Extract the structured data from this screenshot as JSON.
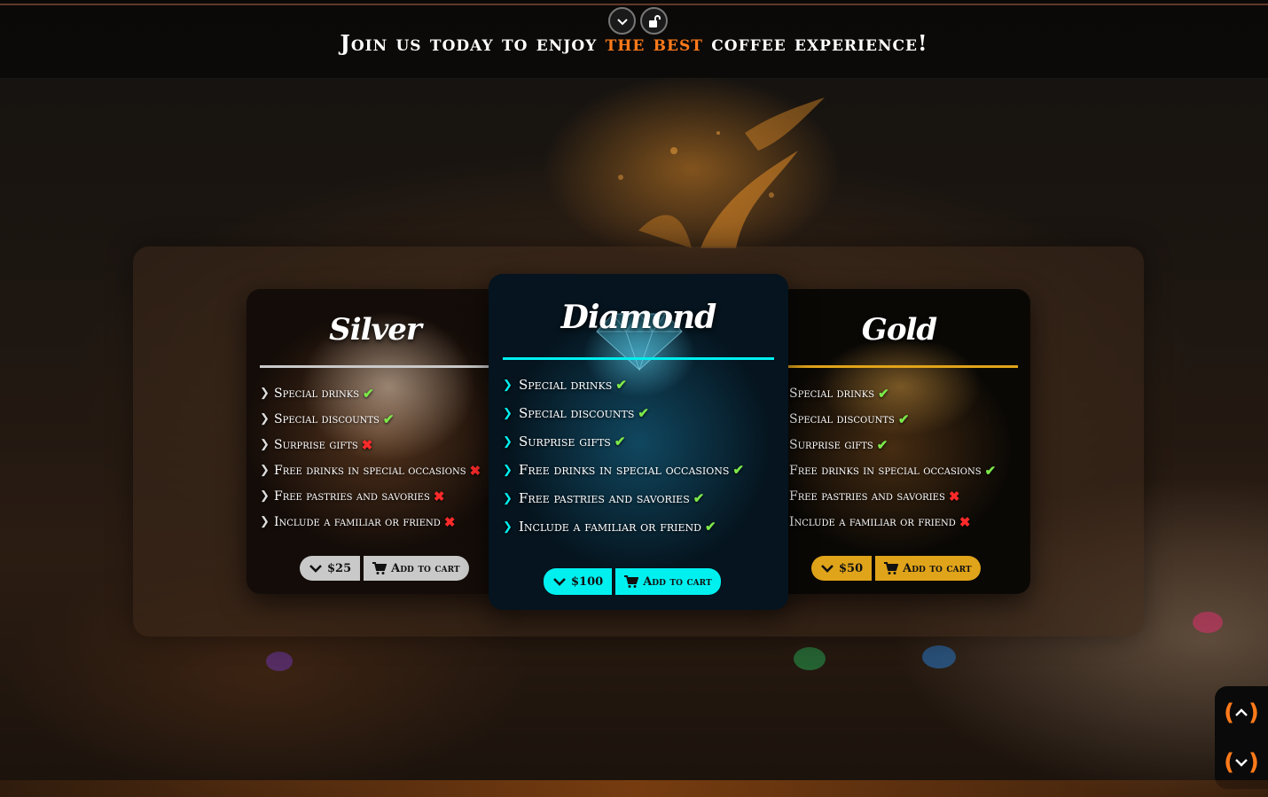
{
  "header": {
    "headline_pre": "Join us today to enjoy ",
    "headline_highlight": "the best",
    "headline_post": " coffee experience!",
    "collapse_icon": "chevron-down-icon",
    "lock_icon": "unlock-icon"
  },
  "colors": {
    "accent": "#ff7a1a",
    "silver": "#c9c9c9",
    "diamond": "#00f0f0",
    "gold": "#e0a41a",
    "check": "#7de84a",
    "cross": "#ff2a2a"
  },
  "plans": {
    "silver": {
      "name": "Silver",
      "features": [
        {
          "label": "Special drinks",
          "included": "✔"
        },
        {
          "label": "Special discounts",
          "included": "✔"
        },
        {
          "label": "Surprise gifts",
          "included": "✖"
        },
        {
          "label": "Free drinks in special occasions",
          "included": "✖"
        },
        {
          "label": "Free pastries and savories",
          "included": "✖"
        },
        {
          "label": "Include a familiar or friend",
          "included": "✖"
        }
      ],
      "price": "$25",
      "cart_label": "Add to cart"
    },
    "diamond": {
      "name": "Diamond",
      "features": [
        {
          "label": "Special drinks",
          "included": "✔"
        },
        {
          "label": "Special discounts",
          "included": "✔"
        },
        {
          "label": "Surprise gifts",
          "included": "✔"
        },
        {
          "label": "Free drinks in special occasions",
          "included": "✔"
        },
        {
          "label": "Free pastries and savories",
          "included": "✔"
        },
        {
          "label": "Include a familiar or friend",
          "included": "✔"
        }
      ],
      "price": "$100",
      "cart_label": "Add to cart"
    },
    "gold": {
      "name": "Gold",
      "features": [
        {
          "label": "Special drinks",
          "included": "✔"
        },
        {
          "label": "Special discounts",
          "included": "✔"
        },
        {
          "label": "Surprise gifts",
          "included": "✔"
        },
        {
          "label": "Free drinks in special occasions",
          "included": "✔"
        },
        {
          "label": "Free pastries and savories",
          "included": "✖"
        },
        {
          "label": "Include a familiar or friend",
          "included": "✖"
        }
      ],
      "price": "$50",
      "cart_label": "Add to cart"
    }
  },
  "side_nav": {
    "up_icon": "scroll-up-icon",
    "down_icon": "scroll-down-icon"
  }
}
